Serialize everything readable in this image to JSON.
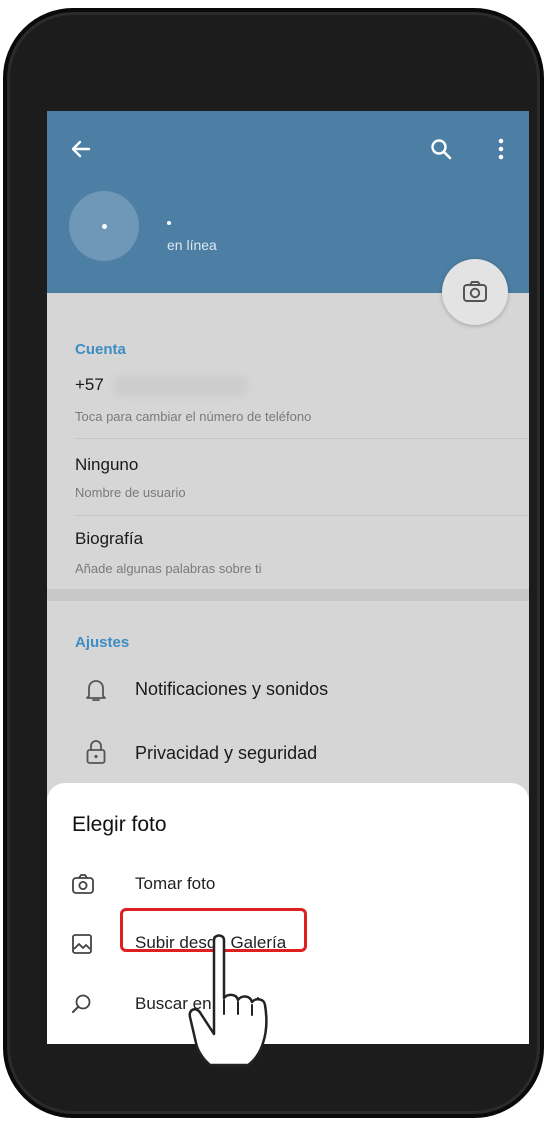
{
  "header": {
    "status": "en línea",
    "accent_color": "#4d7ea3",
    "icons": [
      "back-arrow-icon",
      "search-icon",
      "more-vertical-icon",
      "camera-icon"
    ]
  },
  "account": {
    "title": "Cuenta",
    "phone_prefix": "+57",
    "phone_hint": "Toca para cambiar el número de teléfono",
    "username_value": "Ninguno",
    "username_label": "Nombre de usuario",
    "bio_title": "Biografía",
    "bio_hint": "Añade algunas palabras sobre ti"
  },
  "settings": {
    "title": "Ajustes",
    "items": [
      {
        "label": "Notificaciones y sonidos",
        "icon": "bell-icon"
      },
      {
        "label": "Privacidad y seguridad",
        "icon": "lock-icon"
      }
    ]
  },
  "sheet": {
    "title": "Elegir foto",
    "options": [
      {
        "label": "Tomar foto",
        "icon": "camera-icon"
      },
      {
        "label": "Subir desde Galería",
        "icon": "image-icon"
      },
      {
        "label": "Buscar en la web",
        "icon": "search-icon"
      }
    ],
    "highlight_color": "#e02020"
  }
}
